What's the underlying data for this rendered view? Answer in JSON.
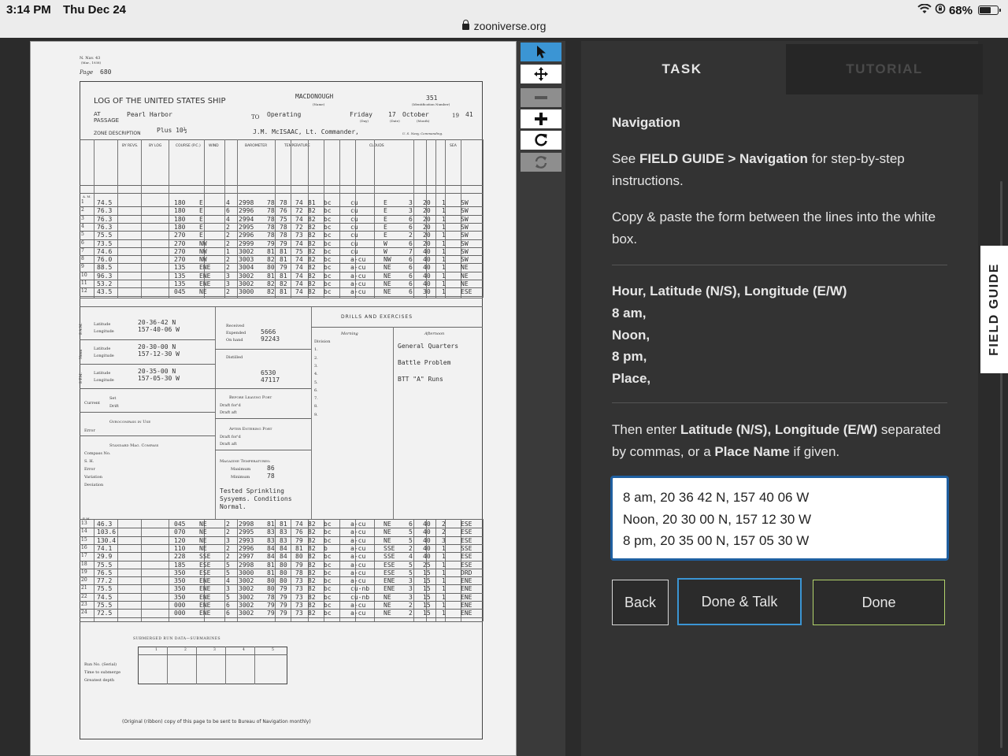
{
  "status_bar": {
    "time": "3:14 PM",
    "date": "Thu Dec 24",
    "url": "zooniverse.org",
    "battery": "68%",
    "battery_level": 0.68
  },
  "toolbar": {
    "tools": [
      {
        "name": "pointer-tool",
        "icon": "cursor-arrow-icon",
        "state": "active"
      },
      {
        "name": "move-tool",
        "icon": "move-arrows-icon",
        "state": "normal"
      },
      {
        "name": "zoom-out-tool",
        "icon": "minus-icon",
        "state": "disabled"
      },
      {
        "name": "zoom-in-tool",
        "icon": "plus-icon",
        "state": "normal"
      },
      {
        "name": "rotate-tool",
        "icon": "rotate-icon",
        "state": "normal"
      },
      {
        "name": "reset-tool",
        "icon": "reset-icon",
        "state": "disabled"
      }
    ]
  },
  "document": {
    "form_no": "N. Nav. 43",
    "form_date": "(Mar., 1938)",
    "page_label": "Page",
    "page_no": "680",
    "title": "LOG OF THE UNITED STATES SHIP",
    "ship_name": "MACDONOUGH",
    "id_number": "351",
    "name_caption": "(Name)",
    "id_caption": "(Identification Number)",
    "at_label": "AT",
    "passage_label": "PASSAGE",
    "location": "Pearl Harbor",
    "to_label": "TO",
    "destination": "Operating",
    "day": "Friday",
    "date_day": "17",
    "month": "October",
    "year_prefix": "19",
    "year": "41",
    "day_caption": "(Day)",
    "date_caption": "(Date)",
    "month_caption": "(Month)",
    "zone_label": "ZONE DESCRIPTION",
    "zone": "Plus 10½",
    "commander": "J.M. McISAAC, Lt. Commander,",
    "commanding_caption": "U. S. Navy, Commanding.",
    "am_label": "A. M.",
    "pm_label": "P. M.",
    "columns": [
      "BY REVS.",
      "BY LOG",
      "COURSE (P.C.)",
      "WIND",
      "BAROMETER",
      "TEMPERATURE",
      "CLOUDS",
      "SEA"
    ],
    "am_rows": [
      {
        "h": "1",
        "speed": "74.5",
        "course": "180",
        "wd": "E",
        "wf": "4",
        "baro": "2998",
        "t1": "78",
        "t2": "78",
        "t3": "74",
        "t4": "81",
        "wx": "bc",
        "cl": "cu",
        "mv": "E",
        "amt": "3",
        "vis": "20",
        "sea": "1",
        "sw": "SW"
      },
      {
        "h": "2",
        "speed": "76.3",
        "course": "180",
        "wd": "E",
        "wf": "6",
        "baro": "2996",
        "t1": "78",
        "t2": "76",
        "t3": "72",
        "t4": "82",
        "wx": "bc",
        "cl": "cu",
        "mv": "E",
        "amt": "3",
        "vis": "20",
        "sea": "1",
        "sw": "SW"
      },
      {
        "h": "3",
        "speed": "76.3",
        "course": "180",
        "wd": "E",
        "wf": "4",
        "baro": "2994",
        "t1": "78",
        "t2": "75",
        "t3": "74",
        "t4": "82",
        "wx": "bc",
        "cl": "cu",
        "mv": "E",
        "amt": "6",
        "vis": "20",
        "sea": "1",
        "sw": "SW"
      },
      {
        "h": "4",
        "speed": "76.3",
        "course": "180",
        "wd": "E",
        "wf": "2",
        "baro": "2995",
        "t1": "78",
        "t2": "78",
        "t3": "72",
        "t4": "82",
        "wx": "bc",
        "cl": "cu",
        "mv": "E",
        "amt": "6",
        "vis": "20",
        "sea": "1",
        "sw": "SW"
      },
      {
        "h": "5",
        "speed": "75.5",
        "course": "270",
        "wd": "E",
        "wf": "2",
        "baro": "2996",
        "t1": "78",
        "t2": "78",
        "t3": "73",
        "t4": "82",
        "wx": "bc",
        "cl": "cu",
        "mv": "E",
        "amt": "2",
        "vis": "20",
        "sea": "1",
        "sw": "SW"
      },
      {
        "h": "6",
        "speed": "73.5",
        "course": "270",
        "wd": "NW",
        "wf": "2",
        "baro": "2999",
        "t1": "79",
        "t2": "79",
        "t3": "74",
        "t4": "82",
        "wx": "bc",
        "cl": "cu",
        "mv": "W",
        "amt": "6",
        "vis": "20",
        "sea": "1",
        "sw": "SW"
      },
      {
        "h": "7",
        "speed": "74.6",
        "course": "270",
        "wd": "NW",
        "wf": "1",
        "baro": "3002",
        "t1": "81",
        "t2": "81",
        "t3": "75",
        "t4": "82",
        "wx": "bc",
        "cl": "cu",
        "mv": "W",
        "amt": "7",
        "vis": "40",
        "sea": "1",
        "sw": "SW"
      },
      {
        "h": "8",
        "speed": "76.0",
        "course": "270",
        "wd": "NW",
        "wf": "2",
        "baro": "3003",
        "t1": "82",
        "t2": "81",
        "t3": "74",
        "t4": "82",
        "wx": "bc",
        "cl": "a-cu",
        "mv": "NW",
        "amt": "6",
        "vis": "40",
        "sea": "1",
        "sw": "SW"
      },
      {
        "h": "9",
        "speed": "88.5",
        "course": "135",
        "wd": "ENE",
        "wf": "2",
        "baro": "3004",
        "t1": "80",
        "t2": "79",
        "t3": "74",
        "t4": "82",
        "wx": "bc",
        "cl": "a-cu",
        "mv": "NE",
        "amt": "6",
        "vis": "40",
        "sea": "1",
        "sw": "NE"
      },
      {
        "h": "10",
        "speed": "96.3",
        "course": "135",
        "wd": "ENE",
        "wf": "3",
        "baro": "3002",
        "t1": "81",
        "t2": "81",
        "t3": "74",
        "t4": "82",
        "wx": "bc",
        "cl": "a-cu",
        "mv": "NE",
        "amt": "6",
        "vis": "40",
        "sea": "1",
        "sw": "NE"
      },
      {
        "h": "11",
        "speed": "53.2",
        "course": "135",
        "wd": "ENE",
        "wf": "3",
        "baro": "3002",
        "t1": "82",
        "t2": "82",
        "t3": "74",
        "t4": "82",
        "wx": "bc",
        "cl": "a-cu",
        "mv": "NE",
        "amt": "6",
        "vis": "40",
        "sea": "1",
        "sw": "NE"
      },
      {
        "h": "12",
        "speed": "43.5",
        "course": "045",
        "wd": "NE",
        "wf": "2",
        "baro": "3000",
        "t1": "82",
        "t2": "81",
        "t3": "74",
        "t4": "82",
        "wx": "bc",
        "cl": "a-cu",
        "mv": "NE",
        "amt": "6",
        "vis": "30",
        "sea": "1",
        "sw": "ESE"
      }
    ],
    "pm_rows": [
      {
        "h": "13",
        "speed": "46.3",
        "course": "045",
        "wd": "NE",
        "wf": "2",
        "baro": "2998",
        "t1": "81",
        "t2": "81",
        "t3": "74",
        "t4": "82",
        "wx": "bc",
        "cl": "a-cu",
        "mv": "NE",
        "amt": "6",
        "vis": "40",
        "sea": "2",
        "sw": "ESE"
      },
      {
        "h": "14",
        "speed": "103.6",
        "course": "070",
        "wd": "NE",
        "wf": "2",
        "baro": "2995",
        "t1": "83",
        "t2": "83",
        "t3": "76",
        "t4": "82",
        "wx": "bc",
        "cl": "a-cu",
        "mv": "NE",
        "amt": "5",
        "vis": "40",
        "sea": "2",
        "sw": "ESE"
      },
      {
        "h": "15",
        "speed": "130.4",
        "course": "120",
        "wd": "NE",
        "wf": "3",
        "baro": "2993",
        "t1": "83",
        "t2": "83",
        "t3": "79",
        "t4": "82",
        "wx": "bc",
        "cl": "a-cu",
        "mv": "NE",
        "amt": "5",
        "vis": "40",
        "sea": "3",
        "sw": "ESE"
      },
      {
        "h": "16",
        "speed": "74.1",
        "course": "110",
        "wd": "NE",
        "wf": "2",
        "baro": "2996",
        "t1": "84",
        "t2": "84",
        "t3": "81",
        "t4": "82",
        "wx": "b",
        "cl": "a-cu",
        "mv": "SSE",
        "amt": "2",
        "vis": "40",
        "sea": "1",
        "sw": "SSE"
      },
      {
        "h": "17",
        "speed": "29.9",
        "course": "228",
        "wd": "SSE",
        "wf": "2",
        "baro": "2997",
        "t1": "84",
        "t2": "84",
        "t3": "80",
        "t4": "82",
        "wx": "bc",
        "cl": "a-cu",
        "mv": "SSE",
        "amt": "4",
        "vis": "40",
        "sea": "1",
        "sw": "ESE"
      },
      {
        "h": "18",
        "speed": "75.5",
        "course": "185",
        "wd": "ESE",
        "wf": "5",
        "baro": "2998",
        "t1": "81",
        "t2": "80",
        "t3": "79",
        "t4": "82",
        "wx": "bc",
        "cl": "a-cu",
        "mv": "ESE",
        "amt": "5",
        "vis": "25",
        "sea": "1",
        "sw": "ESE"
      },
      {
        "h": "19",
        "speed": "76.5",
        "course": "350",
        "wd": "ESE",
        "wf": "5",
        "baro": "3000",
        "t1": "81",
        "t2": "80",
        "t3": "78",
        "t4": "82",
        "wx": "bc",
        "cl": "a-cu",
        "mv": "ESE",
        "amt": "5",
        "vis": "15",
        "sea": "1",
        "sw": "DRD"
      },
      {
        "h": "20",
        "speed": "77.2",
        "course": "350",
        "wd": "ENE",
        "wf": "4",
        "baro": "3002",
        "t1": "80",
        "t2": "80",
        "t3": "73",
        "t4": "82",
        "wx": "bc",
        "cl": "a-cu",
        "mv": "ENE",
        "amt": "3",
        "vis": "15",
        "sea": "1",
        "sw": "ENE"
      },
      {
        "h": "21",
        "speed": "75.5",
        "course": "350",
        "wd": "ENE",
        "wf": "3",
        "baro": "3002",
        "t1": "80",
        "t2": "79",
        "t3": "73",
        "t4": "82",
        "wx": "bc",
        "cl": "cu-nb",
        "mv": "ENE",
        "amt": "3",
        "vis": "15",
        "sea": "1",
        "sw": "ENE"
      },
      {
        "h": "22",
        "speed": "74.5",
        "course": "350",
        "wd": "ENE",
        "wf": "5",
        "baro": "3002",
        "t1": "78",
        "t2": "79",
        "t3": "73",
        "t4": "82",
        "wx": "bc",
        "cl": "cu-nb",
        "mv": "NE",
        "amt": "3",
        "vis": "15",
        "sea": "1",
        "sw": "ENE"
      },
      {
        "h": "23",
        "speed": "75.5",
        "course": "000",
        "wd": "ENE",
        "wf": "6",
        "baro": "3002",
        "t1": "79",
        "t2": "79",
        "t3": "73",
        "t4": "82",
        "wx": "bc",
        "cl": "a-cu",
        "mv": "NE",
        "amt": "2",
        "vis": "15",
        "sea": "1",
        "sw": "ENE"
      },
      {
        "h": "24",
        "speed": "72.5",
        "course": "000",
        "wd": "ENE",
        "wf": "6",
        "baro": "3002",
        "t1": "79",
        "t2": "79",
        "t3": "73",
        "t4": "82",
        "wx": "bc",
        "cl": "a-cu",
        "mv": "NE",
        "amt": "2",
        "vis": "15",
        "sea": "1",
        "sw": "ENE"
      }
    ],
    "positions": [
      {
        "time": "8 A.M.",
        "lat": "20-36-42 N",
        "lon": "157-40-06 W"
      },
      {
        "time": "Noon",
        "lat": "20-30-00 N",
        "lon": "157-12-30 W"
      },
      {
        "time": "8 P.M.",
        "lat": "20-35-00 N",
        "lon": "157-05-30 W"
      }
    ],
    "latitude_label": "Latitude",
    "longitude_label": "Longitude",
    "fuel": {
      "received_label": "Received",
      "expended_label": "Expended",
      "on_hand_label": "On hand",
      "expended": "5666",
      "on_hand": "92243"
    },
    "water": {
      "distilled_label": "Distilled",
      "expended": "6530",
      "on_hand": "47117"
    },
    "drills_title": "DRILLS AND EXERCISES",
    "morning_label": "Morning",
    "afternoon_label": "Afternoon",
    "division_label": "Division",
    "drills": [
      "General Quarters",
      "Battle Problem",
      "BTT \"A\" Runs"
    ],
    "current_label": "Current",
    "set_label": "Set",
    "drift_label": "Drift",
    "before_port_label": "Before Leaving Port",
    "after_port_label": "After Entering Port",
    "draft_fwd_label": "Draft for'd",
    "draft_aft_label": "Draft aft",
    "gyro_label": "Gyrocompass in Use",
    "error_label": "Error",
    "std_compass_label": "Standard Mag. Compass",
    "compass_no_label": "Compass No.",
    "sh_label": "S. H.",
    "variation_label": "Variation",
    "deviation_label": "Deviation",
    "magazine_label": "Magazine Temperatures:",
    "max_label": "Maximum",
    "min_label": "Minimum",
    "mag_max": "86",
    "mag_min": "78",
    "sprinkling_note": "Tested Sprinkling Sysyems. Conditions Normal.",
    "submerged_title": "SUBMERGED RUN DATA—SUBMARINES",
    "run_no_label": "Run No. (Serial)",
    "time_submerge_label": "Time to submerge",
    "depth_label": "Greatest depth",
    "sub_cols": [
      "1",
      "2",
      "3",
      "4",
      "5"
    ],
    "footer": "(Original (ribbon) copy of this page to be sent to Bureau of Navigation monthly)"
  },
  "panel": {
    "tab_task": "TASK",
    "tab_tutorial": "TUTORIAL",
    "heading": "Navigation",
    "guide_pre": "See ",
    "guide_bold": "FIELD GUIDE > Navigation",
    "guide_post": " for step-by-step instructions.",
    "copy_text": "Copy & paste the form between the lines into the white box.",
    "form_header": "Hour, Latitude (N/S), Longitude (E/W)",
    "form_lines": [
      "8 am,",
      "Noon,",
      "8 pm,",
      "Place,"
    ],
    "then_pre": "Then enter ",
    "then_bold1": "Latitude (N/S), Longitude (E/W)",
    "then_mid": " separated by commas, or a ",
    "then_bold2": "Place Name",
    "then_post": " if given.",
    "answer_lines": [
      "8 am, 20 36 42 N, 157 40 06 W",
      "Noon, 20 30 00 N, 157 12 30 W",
      "8 pm, 20 35 00 N, 157 05 30 W"
    ],
    "back_label": "Back",
    "done_talk_label": "Done & Talk",
    "done_label": "Done",
    "field_guide_label": "FIELD GUIDE"
  }
}
